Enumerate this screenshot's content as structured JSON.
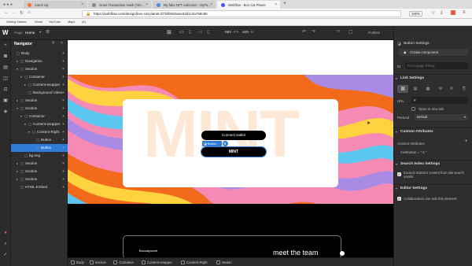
{
  "browser": {
    "tabs": [
      {
        "label": "Catch Up",
        "color": "#ff6d2a"
      },
      {
        "label": "Grant Transaction Hash (Teh...",
        "color": "#888888"
      },
      {
        "label": "My fake NFT collection - MyTo...",
        "color": "#4a90e2"
      },
      {
        "label": "Webflow - Box Cat Planet",
        "color": "#4353ff"
      }
    ],
    "url": "https://webflow.com/design/box-cat-planet-d730b0d2aee3dd1c3a768c86",
    "zoom": "100%",
    "bookmarks": [
      "Getting Started",
      "Gmail",
      "YouTube",
      "Maps",
      "(4)"
    ]
  },
  "webflow_top": {
    "page_label": "Page:",
    "page_name": "Home",
    "width": "992",
    "unit": "PX",
    "zoom": "100",
    "zoom_unit": "%",
    "publish": "Publish"
  },
  "navigator": {
    "title": "Navigator",
    "items": [
      {
        "label": "Body",
        "indent": 0,
        "caret": ""
      },
      {
        "label": "Navigation",
        "indent": 1,
        "caret": "▸"
      },
      {
        "label": "Section",
        "indent": 1,
        "caret": "▾"
      },
      {
        "label": "Container",
        "indent": 2,
        "caret": "▾"
      },
      {
        "label": "Content-wrapper",
        "indent": 3,
        "caret": "▸"
      },
      {
        "label": "Background Video",
        "indent": 3,
        "caret": ""
      },
      {
        "label": "Section",
        "indent": 1,
        "caret": "▸"
      },
      {
        "label": "Section",
        "indent": 1,
        "caret": "▾"
      },
      {
        "label": "Container",
        "indent": 2,
        "caret": "▾"
      },
      {
        "label": "Content-wrapper",
        "indent": 3,
        "caret": "▾"
      },
      {
        "label": "Content-Right",
        "indent": 4,
        "caret": "▾"
      },
      {
        "label": "Button",
        "indent": 5,
        "caret": ""
      },
      {
        "label": "Button",
        "indent": 5,
        "caret": ""
      },
      {
        "label": "bg-img",
        "indent": 2,
        "caret": ""
      },
      {
        "label": "Section",
        "indent": 1,
        "caret": "▸"
      },
      {
        "label": "Section",
        "indent": 1,
        "caret": "▸"
      },
      {
        "label": "Section",
        "indent": 1,
        "caret": "▸"
      },
      {
        "label": "HTML Embed",
        "indent": 1,
        "caret": ""
      }
    ]
  },
  "canvas": {
    "hero_word": "MINT",
    "connect_label": "Connect wallet",
    "selected_tag": "Button",
    "mint_label": "MINT",
    "footer_brand": "Boxcatplanet",
    "footer_cta": "meet the team"
  },
  "right_panel": {
    "button_settings": "Button Settings",
    "create_component": "Create component",
    "id_label": "ID",
    "id_placeholder": "For in-page linking",
    "link_settings": "Link Settings",
    "url_label": "URL",
    "url_value": "#",
    "new_tab": "Open in new tab",
    "preload_label": "Preload",
    "preload_value": "Default",
    "custom_attributes": "Custom Attributes",
    "custom_attributes_row": "Custom Attributes",
    "attr_value": "mintbutton = \" 5 \"",
    "search_index": "Search Index Settings",
    "exclude_text": "Exclude Button's content from site search results",
    "editor_settings": "Editor Settings",
    "collab_text": "Collaborators can edit this element"
  },
  "breadcrumbs": [
    "Body",
    "Section",
    "Container",
    "Content-wrapper",
    "Content-Right",
    "Button"
  ],
  "colors": {
    "accent": "#2f7bd6",
    "panel": "#2e2e2e",
    "wave_orange": "#f26a1b",
    "wave_pink": "#f58ab5",
    "wave_blue": "#5bc7f0",
    "wave_yellow": "#ffd23f",
    "wave_purple": "#a98be6"
  }
}
